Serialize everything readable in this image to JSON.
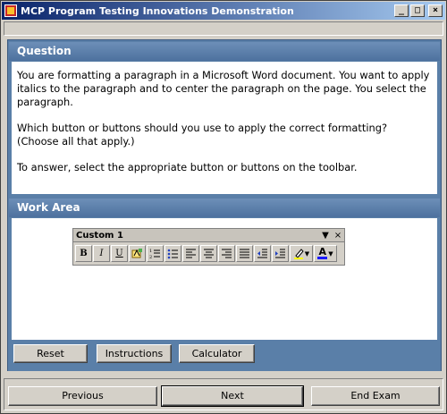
{
  "window": {
    "title": "MCP Program Testing Innovations Demonstration",
    "controls": {
      "minimize": "_",
      "maximize": "□",
      "close": "×"
    }
  },
  "question": {
    "header": "Question",
    "paragraphs": [
      "You are formatting a paragraph in a Microsoft Word document. You want to apply italics to the paragraph and to center the paragraph on the page. You select the paragraph.",
      "Which button or buttons should you use to apply the correct formatting? (Choose all that apply.)",
      "To answer, select the appropriate button or buttons on the toolbar."
    ]
  },
  "work_area": {
    "header": "Work Area",
    "toolbar": {
      "title": "Custom 1",
      "dropdown_glyph": "▼",
      "close_glyph": "×",
      "buttons": {
        "bold": "B",
        "italic": "I",
        "underline": "U",
        "font_color_letter": "A"
      },
      "icons": [
        "bold-icon",
        "italic-icon",
        "underline-icon",
        "style-icon",
        "numbering-icon",
        "bullets-icon",
        "align-left-icon",
        "center-icon",
        "align-right-icon",
        "justify-icon",
        "decrease-indent-icon",
        "increase-indent-icon",
        "highlight-icon",
        "font-color-icon"
      ],
      "font_color": "#1a1aff"
    },
    "buttons": {
      "reset": "Reset",
      "instructions": "Instructions",
      "calculator": "Calculator"
    }
  },
  "nav": {
    "previous": "Previous",
    "next": "Next",
    "end_exam": "End Exam"
  },
  "colors": {
    "title_gradient_start": "#0a246a",
    "panel": "#5a7fa8",
    "face": "#d4d0c8"
  }
}
